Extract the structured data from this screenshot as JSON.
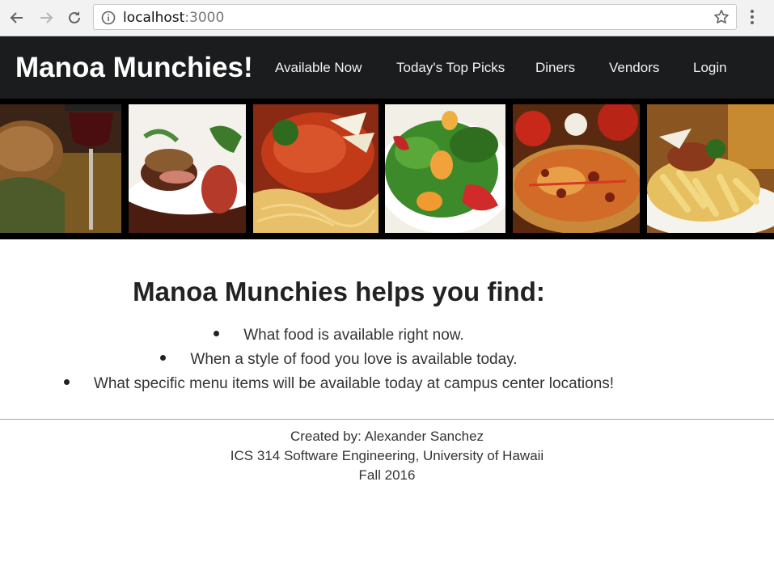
{
  "browser": {
    "url_host": "localhost",
    "url_port": ":3000",
    "icons": [
      "back-arrow-icon",
      "forward-arrow-icon",
      "reload-icon",
      "info-icon",
      "bookmark-star-icon",
      "menu-dots-icon"
    ]
  },
  "navbar": {
    "brand": "Manoa Munchies!",
    "items": [
      {
        "label": "Available Now"
      },
      {
        "label": "Today's Top Picks"
      },
      {
        "label": "Diners"
      },
      {
        "label": "Vendors"
      },
      {
        "label": "Login"
      }
    ],
    "background": "#1b1c1d"
  },
  "banner": {
    "photos": [
      "bread-and-wine-photo",
      "steak-plate-photo",
      "spaghetti-photo",
      "salad-photo",
      "pizza-photo",
      "pasta-photo"
    ]
  },
  "main": {
    "headline": "Manoa Munchies helps you find:",
    "bullets": [
      "What food is available right now.",
      "When a style of food you love is available today.",
      "What specific menu items will be available today at campus center locations!"
    ]
  },
  "footer": {
    "created_by": "Created by: Alexander Sanchez",
    "course": "ICS 314 Software Engineering, University of Hawaii",
    "term": "Fall 2016"
  }
}
